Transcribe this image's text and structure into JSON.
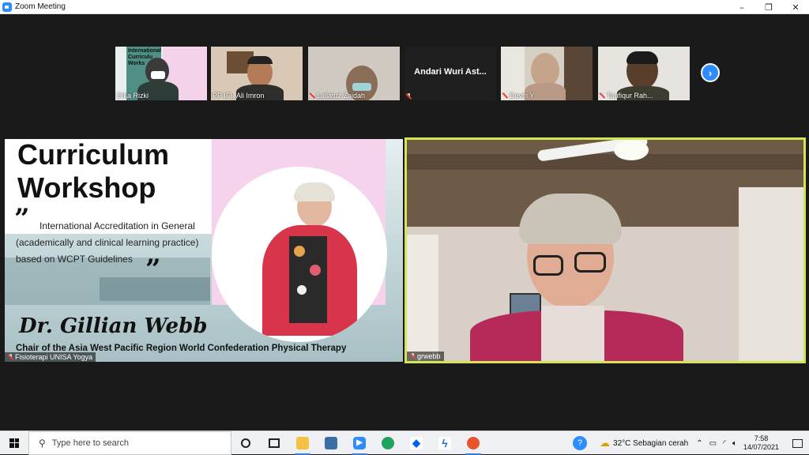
{
  "window": {
    "title": "Zoom Meeting",
    "controls": [
      "–",
      "❐",
      "✕"
    ]
  },
  "gallery": [
    {
      "name": "Dika Rizki",
      "muted": false,
      "slide_text": [
        "International",
        "Curriculu",
        "Works"
      ]
    },
    {
      "name": "PP IFI_Ali Imron",
      "muted": false
    },
    {
      "name": "Lailatuz Zaidah",
      "muted": true
    },
    {
      "name": "Andari Wuri Ast...",
      "muted": true,
      "video_off": true
    },
    {
      "name": "Devin Y",
      "muted": true
    },
    {
      "name": "Taufiqur Rah...",
      "muted": true
    }
  ],
  "next_page_icon": "chevron-right-icon",
  "presentation": {
    "title_line1": "Curriculum",
    "title_line2": "Workshop",
    "open_quote": "”",
    "close_quote": "”",
    "body": "International Accreditation in General (academically and clinical learning practice) based on WCPT Guidelines",
    "speaker": "Dr. Gillian Webb",
    "role": "Chair of the Asia West Pacific Region World Confederation Physical Therapy",
    "host_label": "Fisioterapi UNISA Yogya"
  },
  "active_speaker": {
    "name": "grwebb"
  },
  "taskbar": {
    "search_placeholder": "Type here to search",
    "apps": [
      "cortana-icon",
      "task-view-icon",
      "file-explorer-icon",
      "store-icon",
      "zoom-icon",
      "edge-icon",
      "dropbox-icon",
      "app-icon",
      "firefox-icon"
    ],
    "weather": "32°C  Sebagian cerah",
    "time": "7:58",
    "date": "14/07/2021"
  },
  "colors": {
    "zoom_blue": "#2d8cff",
    "active_border": "#d4e35a",
    "muted_red": "#e8413c"
  }
}
